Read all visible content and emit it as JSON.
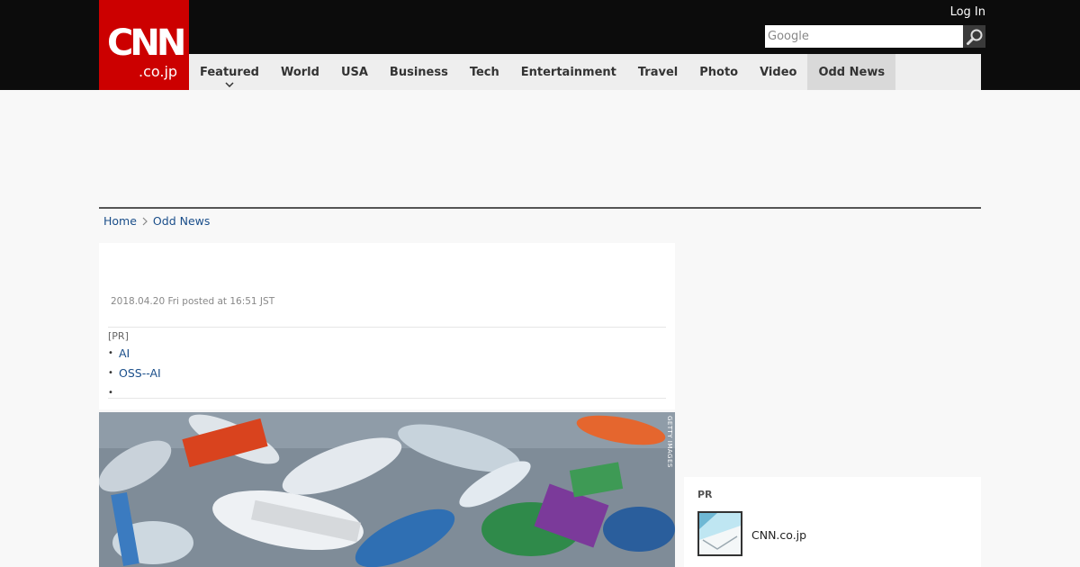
{
  "header": {
    "logo_main": "CNN",
    "logo_sub": ".co.jp",
    "login_label": "Log In",
    "search_placeholder": "Google"
  },
  "nav": {
    "items": [
      {
        "label": "Featured"
      },
      {
        "label": "World"
      },
      {
        "label": "USA"
      },
      {
        "label": "Business"
      },
      {
        "label": "Tech"
      },
      {
        "label": "Entertainment"
      },
      {
        "label": "Travel"
      },
      {
        "label": "Photo"
      },
      {
        "label": "Video"
      },
      {
        "label": "Odd News"
      }
    ],
    "active": "Odd News"
  },
  "breadcrumb": {
    "home": "Home",
    "current": "Odd News"
  },
  "article": {
    "date": "2018.04.20 Fri posted at 16:51 JST",
    "pr_tag": "[PR]",
    "pr_links": [
      "AI",
      "OSS--AI",
      ""
    ]
  },
  "hero": {
    "credit": "GETTY IMAGES"
  },
  "sidebar": {
    "pr_label": "PR",
    "item_text": "CNN.co.jp"
  },
  "colors": {
    "brand_red": "#cc0000",
    "header_bg": "#0c0c0c",
    "nav_bg": "#eeeeee",
    "nav_active_bg": "#d9d9d9",
    "link": "#1a4e8a"
  }
}
